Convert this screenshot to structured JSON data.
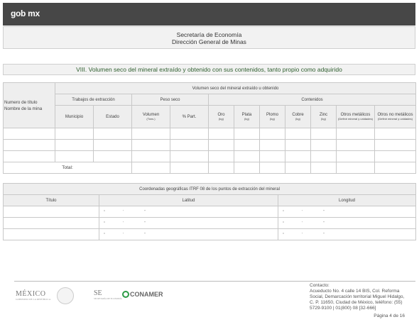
{
  "header": {
    "brand": "gob mx"
  },
  "office": {
    "line1": "Secretaría de Economía",
    "line2": "Dirección General de Minas"
  },
  "section": {
    "title": "VIII. Volumen seco del mineral extraído y obtenido con sus contenidos, tanto propio como adquirido"
  },
  "table1": {
    "row_label_1": "Numero de título",
    "row_label_2": "Nombre de la mina",
    "group_header": "Volumen seco del mineral extraído u obtenido",
    "trabajos": "Trabajos de extracción",
    "peso": "Peso seco",
    "contenidos": "Contenidos",
    "municipio": "Municipio",
    "estado": "Estado",
    "volumen": "Volumen",
    "volumen_unit": "(Tons.)",
    "part": "% Part.",
    "oro": "Oro",
    "plata": "Plata",
    "plomo": "Plomo",
    "cobre": "Cobre",
    "zinc": "Zinc",
    "unit_kg": "(kg)",
    "otros_met": "Otros metálicos",
    "otros_met_sub": "(Definir mineral y unidades)",
    "otros_nomet": "Otros no metálicos",
    "otros_nomet_sub": "(Definir mineral y unidades)",
    "total": "Total:"
  },
  "table2": {
    "caption": "Coordenadas geográficas ITRF 08 de los puntos de extracción del mineral",
    "titulo": "Título",
    "latitud": "Latitud",
    "longitud": "Longitud"
  },
  "footer": {
    "logo_mexico": "MÉXICO",
    "logo_mexico_sub": "GOBIERNO DE LA REPÚBLICA",
    "logo_se": "SE",
    "logo_se_sub": "SECRETARÍA DE ECONOMÍA",
    "logo_conamer": "CONAMER",
    "contact": "Contacto:",
    "address1": "Acueducto No. 4 calle 14 BIS, Col. Reforma",
    "address2": "Social, Demarcación territorial Miguel Hidalgo,",
    "address3": "C. P. 11650, Ciudad de México, teléfono: (55)",
    "address4": "5729-9100 | 01(800) 08 [32-666]",
    "page": "Página 4 de 16"
  }
}
